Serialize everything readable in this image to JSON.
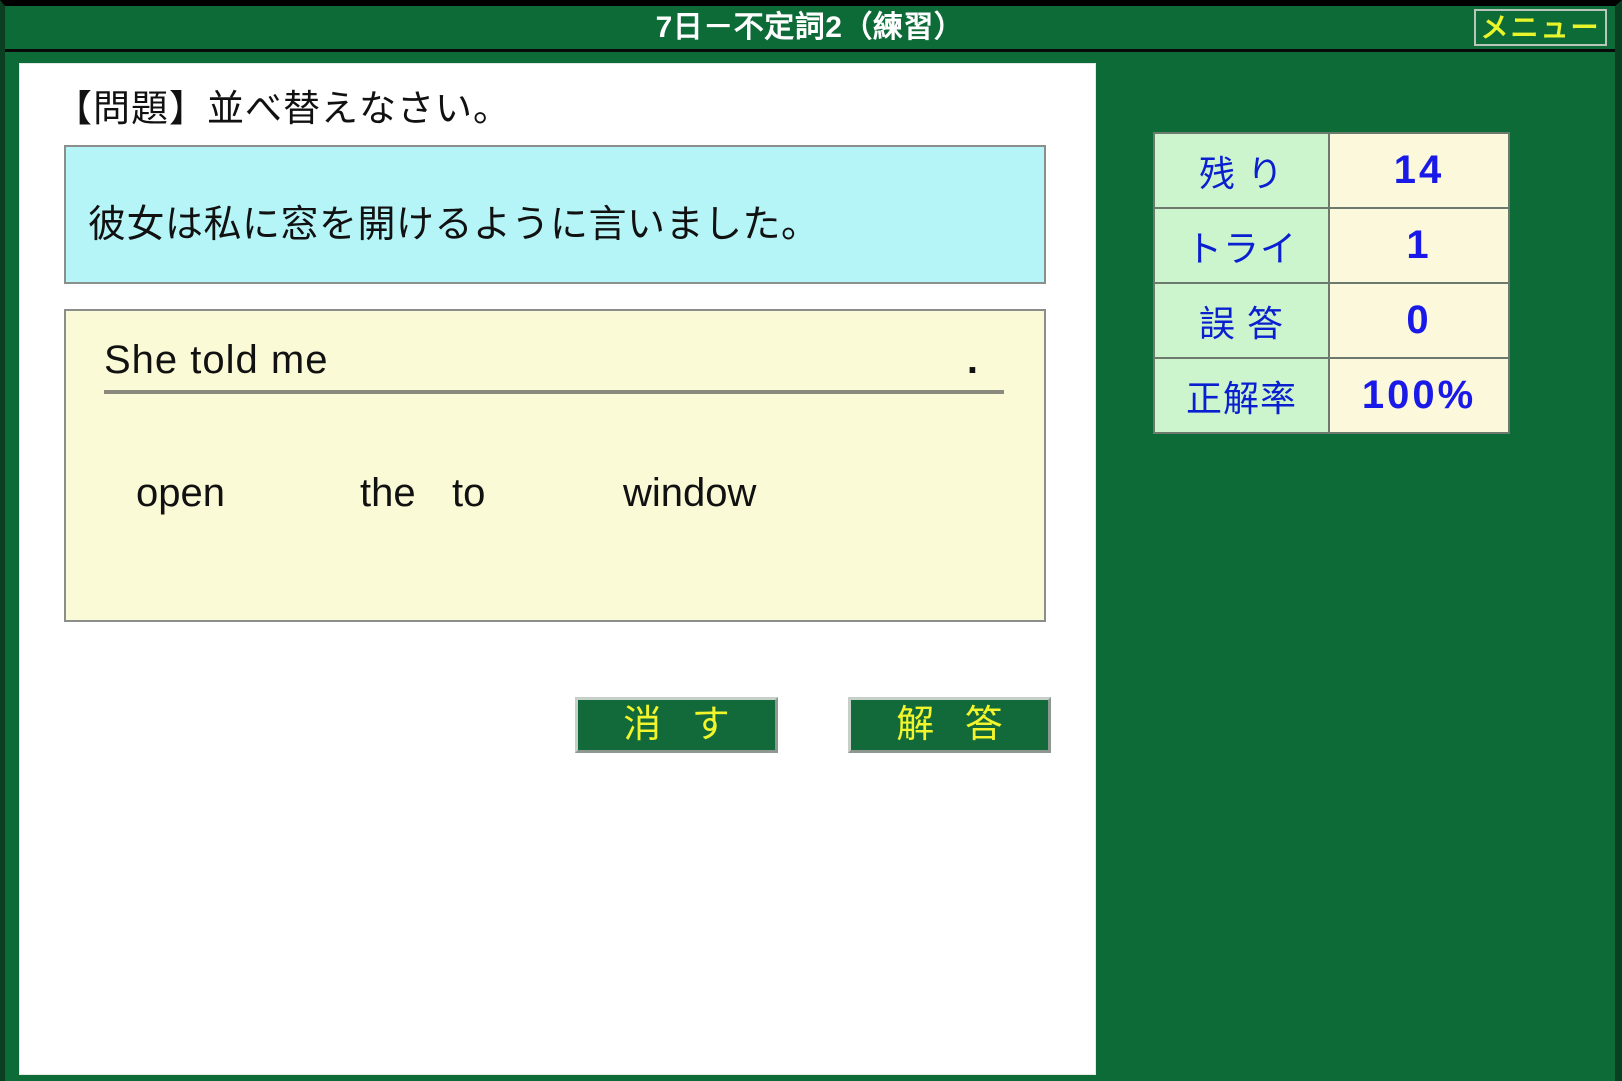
{
  "titlebar": {
    "title": "7日－不定詞2（練習）",
    "menu_label": "メニュー"
  },
  "main": {
    "instruction": "【問題】並べ替えなさい。",
    "japanese_sentence": "彼女は私に窓を開けるように言いました。",
    "answer_line": {
      "current_text": "She told me",
      "terminator": "."
    },
    "word_bank": [
      "open",
      "the",
      "to",
      "window"
    ],
    "buttons": {
      "clear_label": "消 す",
      "answer_label": "解 答"
    }
  },
  "stats": {
    "rows": [
      {
        "label": "残  り",
        "value": "14"
      },
      {
        "label": "トライ",
        "value": "1"
      },
      {
        "label": "誤  答",
        "value": "0"
      },
      {
        "label": "正解率",
        "value": "100%"
      }
    ]
  },
  "colors": {
    "frame_green": "#0d6b38",
    "panel_white": "#ffffff",
    "prompt_cyan": "#b6f5f7",
    "work_cream": "#fbfad6",
    "stat_label_green": "#cdf5cd",
    "stat_value_cream": "#fbf8dc",
    "stat_text_blue": "#1a1ae8",
    "button_text_yellow": "#f2f52b"
  }
}
